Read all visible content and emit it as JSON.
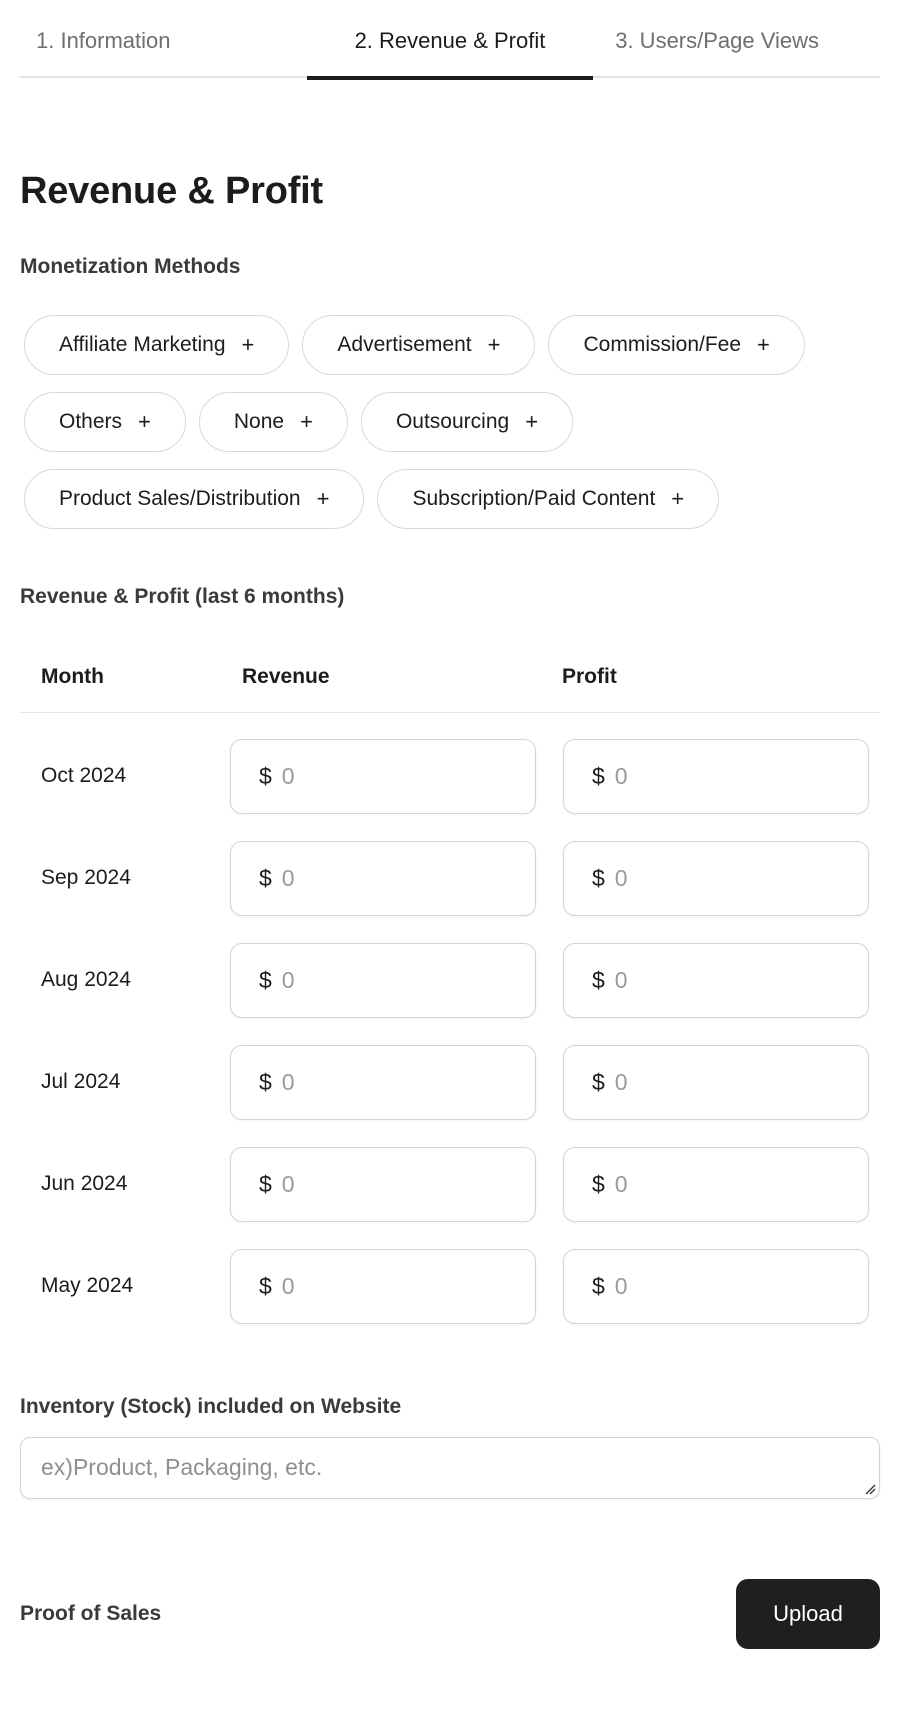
{
  "tabs": [
    {
      "label": "1. Information",
      "active": false
    },
    {
      "label": "2. Revenue & Profit",
      "active": true
    },
    {
      "label": "3. Users/Page Views",
      "active": false
    }
  ],
  "section_title": "Revenue & Profit",
  "monetization": {
    "label": "Monetization Methods",
    "add_icon": "plus-icon",
    "chips": [
      "Affiliate Marketing",
      "Advertisement",
      "Commission/Fee",
      "Others",
      "None",
      "Outsourcing",
      "Product Sales/Distribution",
      "Subscription/Paid Content"
    ],
    "plus_glyph": "+"
  },
  "revenue_profit": {
    "label": "Revenue & Profit (last 6 months)",
    "columns": [
      "Month",
      "Revenue",
      "Profit"
    ],
    "currency_symbol": "$",
    "rows": [
      {
        "month": "Oct 2024",
        "revenue_placeholder": "0",
        "profit_placeholder": "0"
      },
      {
        "month": "Sep 2024",
        "revenue_placeholder": "0",
        "profit_placeholder": "0"
      },
      {
        "month": "Aug 2024",
        "revenue_placeholder": "0",
        "profit_placeholder": "0"
      },
      {
        "month": "Jul 2024",
        "revenue_placeholder": "0",
        "profit_placeholder": "0"
      },
      {
        "month": "Jun 2024",
        "revenue_placeholder": "0",
        "profit_placeholder": "0"
      },
      {
        "month": "May 2024",
        "revenue_placeholder": "0",
        "profit_placeholder": "0"
      }
    ]
  },
  "inventory": {
    "label": "Inventory (Stock) included on Website",
    "placeholder": "ex)Product, Packaging, etc.",
    "value": ""
  },
  "proof_of_sales": {
    "label": "Proof of Sales",
    "upload_label": "Upload"
  }
}
